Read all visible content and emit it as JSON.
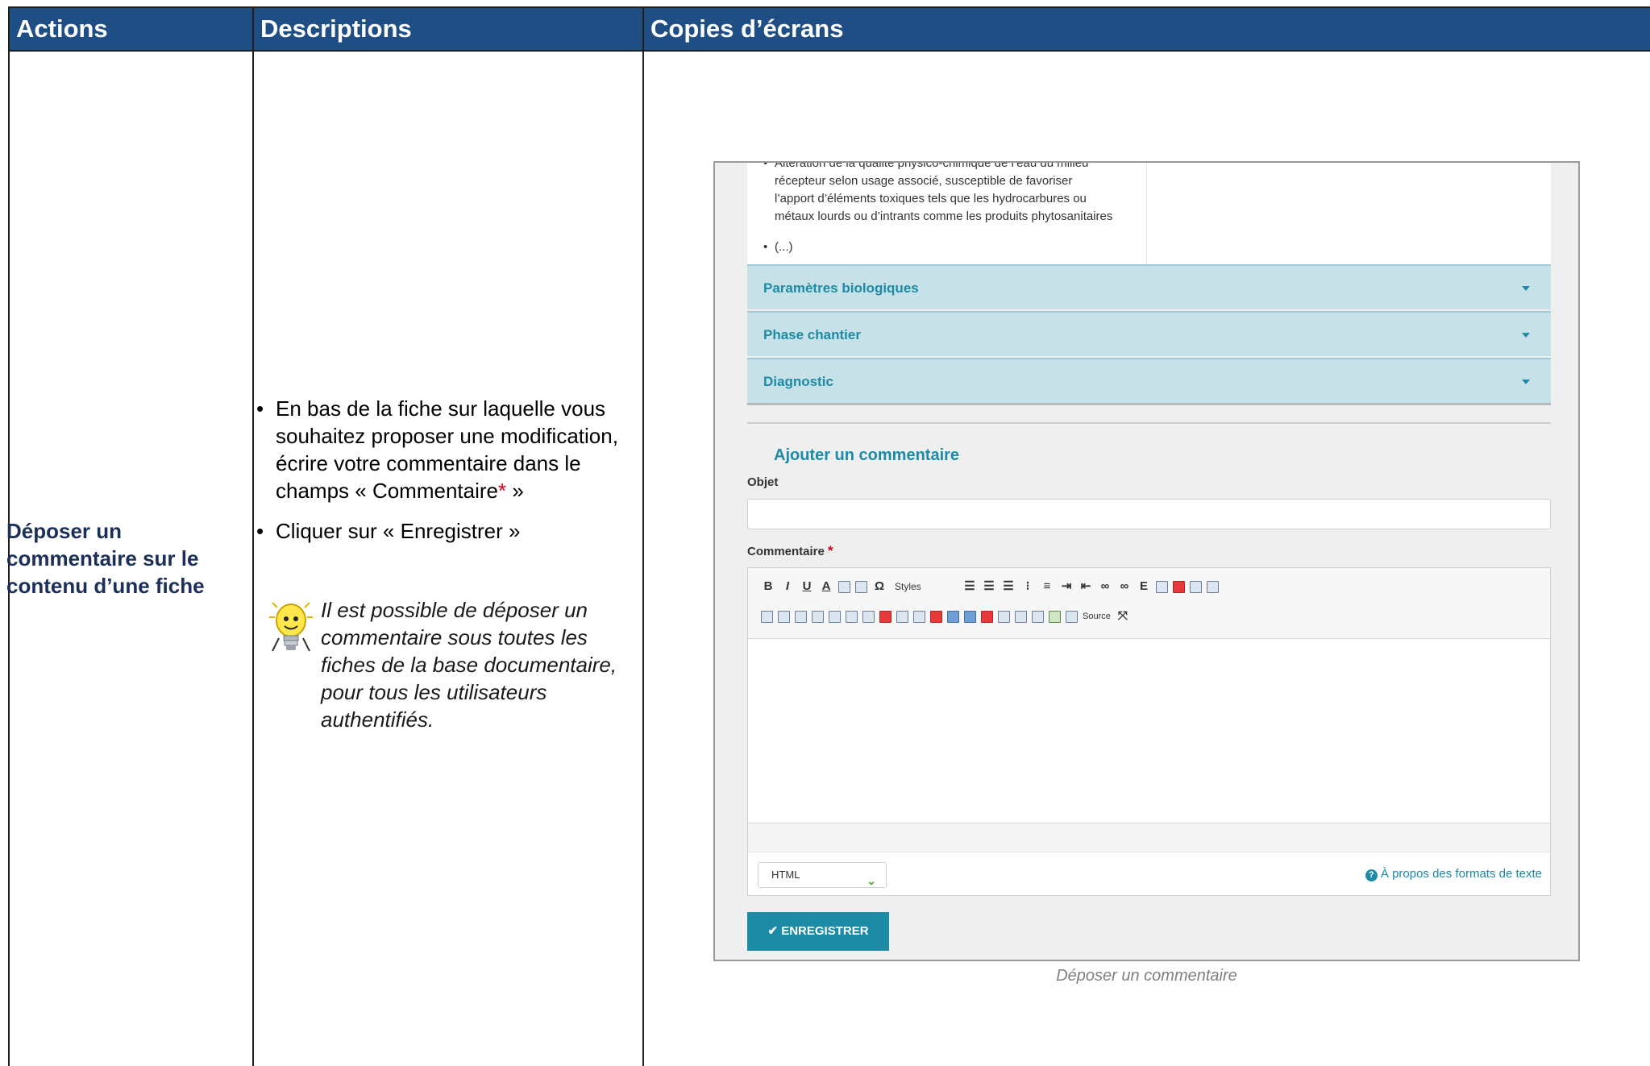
{
  "table": {
    "headers": [
      "Actions",
      "Descriptions",
      "Copies d’écrans"
    ],
    "action_title": "Déposer un commentaire sur le contenu d’une fiche",
    "description_steps": {
      "step1_text": "En bas de la fiche sur laquelle vous souhaitez proposer une modification, écrire votre commentaire dans le champs « Commentaire",
      "step1_required_mark": "*",
      "step1_end": " »",
      "step2": "Cliquer sur « Enregistrer »"
    },
    "tip": "Il est possible de déposer un commentaire sous toutes les fiches de la base documentaire, pour tous les utilisateurs authentifiés.",
    "screenshot_caption": "Déposer un commentaire"
  },
  "screenshot": {
    "content_lines": {
      "line1": "Altération de la qualité physico-chimique de l’eau du milieu",
      "line2": "récepteur selon usage associé, susceptible de favoriser",
      "line3": "l’apport d’éléments toxiques tels que les hydrocarbures ou",
      "line4": "métaux lourds ou d’intrants comme les produits phytosanitaires",
      "etc": "(...)"
    },
    "accordions": [
      "Paramètres biologiques",
      "Phase chantier",
      "Diagnostic"
    ],
    "comment_section_title": "Ajouter un commentaire",
    "subject_label": "Objet",
    "comment_label": "Commentaire",
    "required_mark": "*",
    "toolbar": {
      "bold": "B",
      "italic": "I",
      "underline": "U",
      "text_color": "A",
      "omega": "Ω",
      "styles": "Styles",
      "embed": "E",
      "source": "Source"
    },
    "format_select": "HTML",
    "help_link": "À propos des formats de texte",
    "save_button": "✔ ENREGISTRER"
  }
}
